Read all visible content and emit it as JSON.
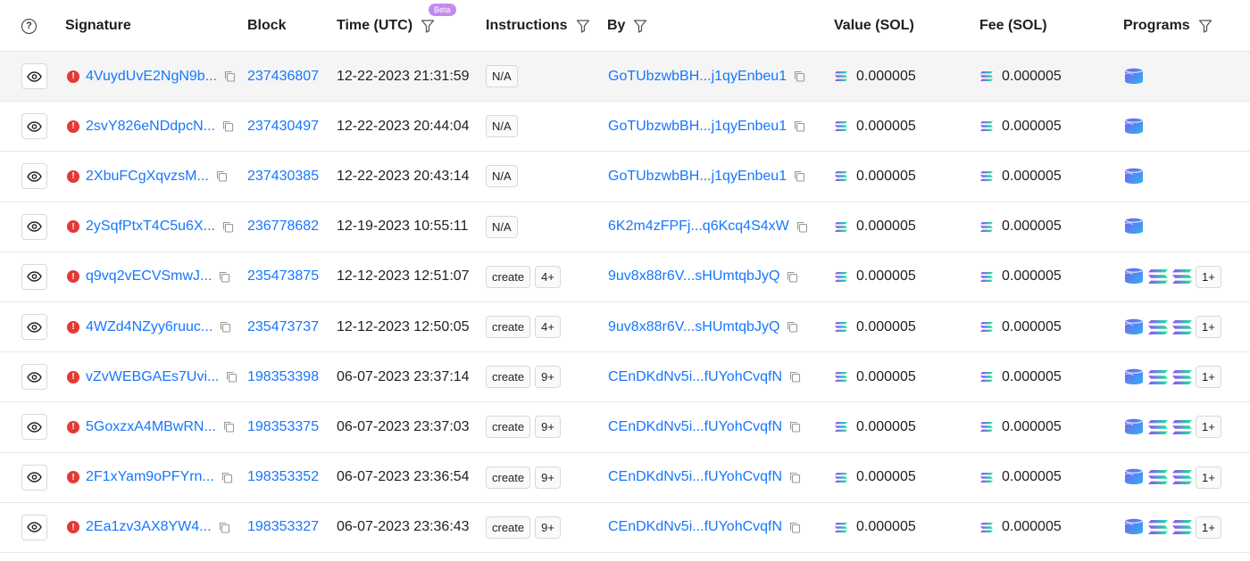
{
  "headers": {
    "signature": "Signature",
    "block": "Block",
    "time": "Time (UTC)",
    "beta": "Beta",
    "instructions": "Instructions",
    "by": "By",
    "value": "Value (SOL)",
    "fee": "Fee (SOL)",
    "programs": "Programs"
  },
  "colors": {
    "link": "#1677ff",
    "error": "#e53935",
    "beta": "#c58af0"
  },
  "rows": [
    {
      "signature": "4VuydUvE2NgN9b...",
      "block": "237436807",
      "time": "12-22-2023 21:31:59",
      "instr": [
        "N/A"
      ],
      "by": "GoTUbzwbBH...j1qyEnbeu1",
      "value": "0.000005",
      "fee": "0.000005",
      "programs": [
        "program-icon"
      ],
      "more": ""
    },
    {
      "signature": "2svY826eNDdpcN...",
      "block": "237430497",
      "time": "12-22-2023 20:44:04",
      "instr": [
        "N/A"
      ],
      "by": "GoTUbzwbBH...j1qyEnbeu1",
      "value": "0.000005",
      "fee": "0.000005",
      "programs": [
        "program-icon"
      ],
      "more": ""
    },
    {
      "signature": "2XbuFCgXqvzsM...",
      "block": "237430385",
      "time": "12-22-2023 20:43:14",
      "instr": [
        "N/A"
      ],
      "by": "GoTUbzwbBH...j1qyEnbeu1",
      "value": "0.000005",
      "fee": "0.000005",
      "programs": [
        "program-icon"
      ],
      "more": ""
    },
    {
      "signature": "2ySqfPtxT4C5u6X...",
      "block": "236778682",
      "time": "12-19-2023 10:55:11",
      "instr": [
        "N/A"
      ],
      "by": "6K2m4zFPFj...q6Kcq4S4xW",
      "value": "0.000005",
      "fee": "0.000005",
      "programs": [
        "program-icon"
      ],
      "more": ""
    },
    {
      "signature": "q9vq2vECVSmwJ...",
      "block": "235473875",
      "time": "12-12-2023 12:51:07",
      "instr": [
        "create",
        "4+"
      ],
      "by": "9uv8x88r6V...sHUmtqbJyQ",
      "value": "0.000005",
      "fee": "0.000005",
      "programs": [
        "program-icon",
        "solana-icon",
        "solana-icon"
      ],
      "more": "1+"
    },
    {
      "signature": "4WZd4NZyy6ruuc...",
      "block": "235473737",
      "time": "12-12-2023 12:50:05",
      "instr": [
        "create",
        "4+"
      ],
      "by": "9uv8x88r6V...sHUmtqbJyQ",
      "value": "0.000005",
      "fee": "0.000005",
      "programs": [
        "program-icon",
        "solana-icon",
        "solana-icon"
      ],
      "more": "1+"
    },
    {
      "signature": "vZvWEBGAEs7Uvi...",
      "block": "198353398",
      "time": "06-07-2023 23:37:14",
      "instr": [
        "create",
        "9+"
      ],
      "by": "CEnDKdNv5i...fUYohCvqfN",
      "value": "0.000005",
      "fee": "0.000005",
      "programs": [
        "program-icon",
        "solana-icon",
        "solana-icon"
      ],
      "more": "1+"
    },
    {
      "signature": "5GoxzxA4MBwRN...",
      "block": "198353375",
      "time": "06-07-2023 23:37:03",
      "instr": [
        "create",
        "9+"
      ],
      "by": "CEnDKdNv5i...fUYohCvqfN",
      "value": "0.000005",
      "fee": "0.000005",
      "programs": [
        "program-icon",
        "solana-icon",
        "solana-icon"
      ],
      "more": "1+"
    },
    {
      "signature": "2F1xYam9oPFYrn...",
      "block": "198353352",
      "time": "06-07-2023 23:36:54",
      "instr": [
        "create",
        "9+"
      ],
      "by": "CEnDKdNv5i...fUYohCvqfN",
      "value": "0.000005",
      "fee": "0.000005",
      "programs": [
        "program-icon",
        "solana-icon",
        "solana-icon"
      ],
      "more": "1+"
    },
    {
      "signature": "2Ea1zv3AX8YW4...",
      "block": "198353327",
      "time": "06-07-2023 23:36:43",
      "instr": [
        "create",
        "9+"
      ],
      "by": "CEnDKdNv5i...fUYohCvqfN",
      "value": "0.000005",
      "fee": "0.000005",
      "programs": [
        "program-icon",
        "solana-icon",
        "solana-icon"
      ],
      "more": "1+"
    }
  ]
}
